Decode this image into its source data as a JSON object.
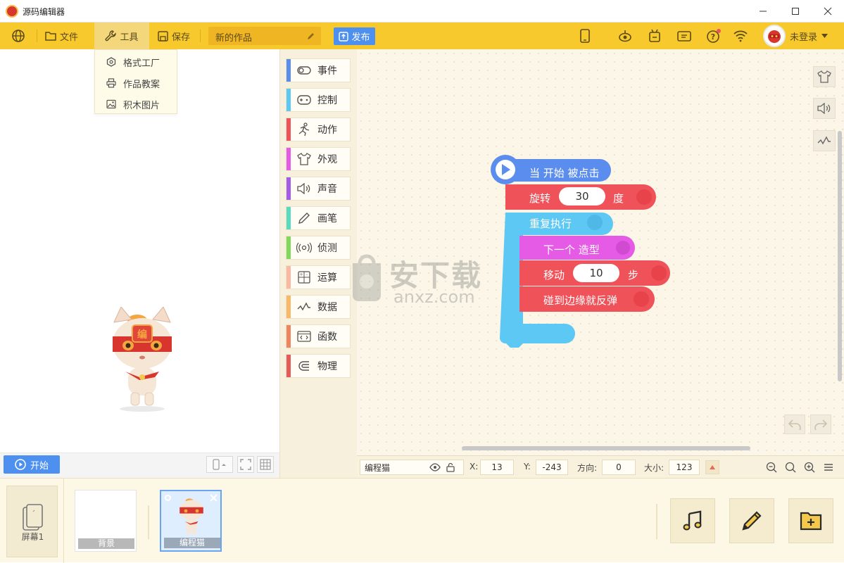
{
  "window": {
    "title": "源码编辑器",
    "controls": [
      "minimize",
      "maximize",
      "close"
    ]
  },
  "toolbar": {
    "file_label": "文件",
    "tools_label": "工具",
    "save_label": "保存",
    "project_name": "新的作品",
    "publish_label": "发布",
    "user_label": "未登录"
  },
  "tools_menu": {
    "items": [
      {
        "label": "格式工厂",
        "icon": "format-factory-icon"
      },
      {
        "label": "作品教案",
        "icon": "printer-icon"
      },
      {
        "label": "积木图片",
        "icon": "image-icon"
      }
    ]
  },
  "stage": {
    "start_label": "开始"
  },
  "categories": [
    {
      "label": "事件",
      "color": "#5b8def",
      "icon": "toggle-icon"
    },
    {
      "label": "控制",
      "color": "#5ec8f5",
      "icon": "gamepad-icon"
    },
    {
      "label": "动作",
      "color": "#f0525a",
      "icon": "running-icon"
    },
    {
      "label": "外观",
      "color": "#e55be6",
      "icon": "shirt-icon"
    },
    {
      "label": "声音",
      "color": "#a35be8",
      "icon": "speaker-icon"
    },
    {
      "label": "画笔",
      "color": "#57dbbe",
      "icon": "pencil-icon"
    },
    {
      "label": "侦测",
      "color": "#7ed95a",
      "icon": "radar-icon"
    },
    {
      "label": "运算",
      "color": "#fbb9a3",
      "icon": "calculator-icon"
    },
    {
      "label": "数据",
      "color": "#f7b86a",
      "icon": "chart-line-icon"
    },
    {
      "label": "函数",
      "color": "#ef8560",
      "icon": "function-icon"
    },
    {
      "label": "物理",
      "color": "#e65a5a",
      "icon": "magnet-icon"
    }
  ],
  "script": {
    "hat_label": "当 开始 被点击",
    "rotate_label": "旋转",
    "rotate_value": "30",
    "rotate_unit": "度",
    "repeat_label": "重复执行",
    "costume_label": "下一个 造型",
    "move_label": "移动",
    "move_value": "10",
    "move_unit": "步",
    "bounce_label": "碰到边缘就反弹"
  },
  "watermark": {
    "cn": "安下载",
    "en": "anxz.com"
  },
  "properties": {
    "sprite_name": "编程猫",
    "x_label": "X:",
    "x_value": "13",
    "y_label": "Y:",
    "y_value": "-243",
    "dir_label": "方向:",
    "dir_value": "0",
    "size_label": "大小:",
    "size_value": "123"
  },
  "bottom": {
    "screen_label": "屏幕1",
    "background_label": "背景",
    "sprite_label": "编程猫"
  },
  "colors": {
    "toolbar": "#f8c92c",
    "accent_blue": "#4d90f0",
    "event_block": "#5b8def",
    "motion_block": "#f0525a",
    "control_block": "#5ec8f5",
    "looks_block": "#e55be6"
  }
}
